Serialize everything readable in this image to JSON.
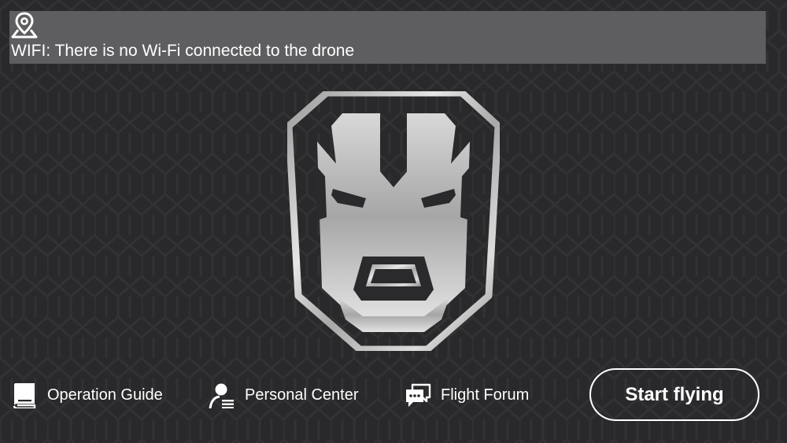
{
  "status_banner": {
    "icon": "location-pin-icon",
    "wifi_text": "WIFI: There is no Wi-Fi connected to the drone"
  },
  "logo": {
    "icon": "drone-brand-logo"
  },
  "bottom_nav": {
    "items": [
      {
        "label": "Operation Guide",
        "icon": "book-icon"
      },
      {
        "label": "Personal Center",
        "icon": "user-list-icon"
      },
      {
        "label": "Flight Forum",
        "icon": "chat-bubbles-icon"
      }
    ],
    "start_button_label": "Start flying"
  },
  "colors": {
    "background": "#29292b",
    "banner": "#5e5e61",
    "text": "#ffffff",
    "logo_metal": "#c8c8c8"
  }
}
